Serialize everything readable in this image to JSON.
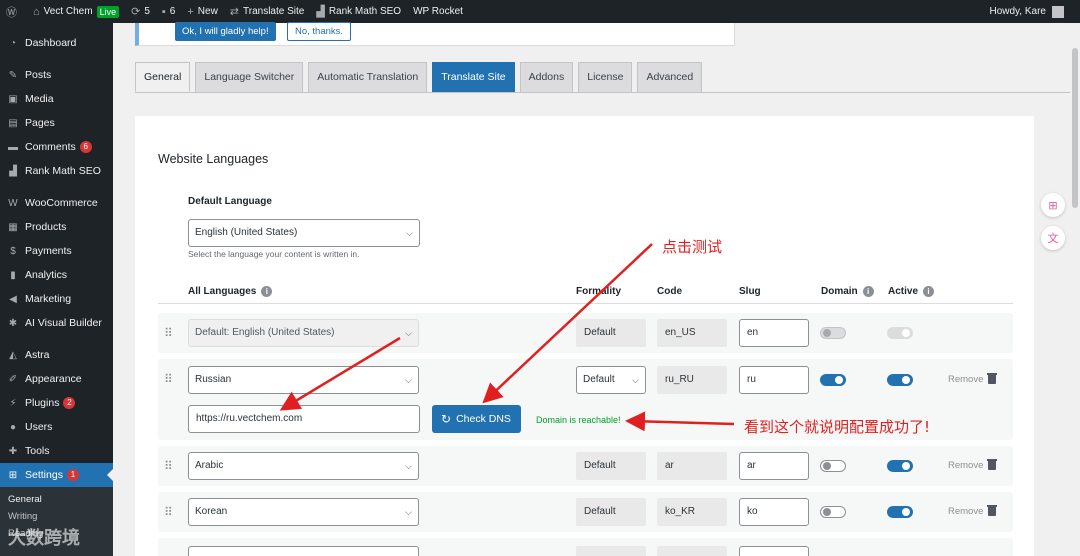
{
  "adminbar": {
    "site_name": "Vect Chem",
    "live_badge": "Live",
    "updates_count": "5",
    "comments_count": "6",
    "new_label": "New",
    "translate_site": "Translate Site",
    "rank_math": "Rank Math SEO",
    "wp_rocket": "WP Rocket",
    "howdy": "Howdy, Kare"
  },
  "sidebar": {
    "items": [
      {
        "label": "Dashboard",
        "icon": "dashboard-icon"
      },
      {
        "label": "Posts",
        "icon": "pin-icon"
      },
      {
        "label": "Media",
        "icon": "media-icon"
      },
      {
        "label": "Pages",
        "icon": "page-icon"
      },
      {
        "label": "Comments",
        "icon": "comment-icon",
        "badge": "6"
      },
      {
        "label": "Rank Math SEO",
        "icon": "chart-icon"
      },
      {
        "label": "WooCommerce",
        "icon": "woo-icon"
      },
      {
        "label": "Products",
        "icon": "box-icon"
      },
      {
        "label": "Payments",
        "icon": "dollar-icon"
      },
      {
        "label": "Analytics",
        "icon": "bar-chart-icon"
      },
      {
        "label": "Marketing",
        "icon": "megaphone-icon"
      },
      {
        "label": "AI Visual Builder",
        "icon": "gear-icon"
      },
      {
        "label": "Astra",
        "icon": "astra-icon"
      },
      {
        "label": "Appearance",
        "icon": "brush-icon"
      },
      {
        "label": "Plugins",
        "icon": "plug-icon",
        "badge": "2"
      },
      {
        "label": "Users",
        "icon": "user-icon"
      },
      {
        "label": "Tools",
        "icon": "wrench-icon"
      },
      {
        "label": "Settings",
        "icon": "settings-icon",
        "badge": "1"
      }
    ],
    "submenu": [
      "General",
      "Writing",
      "Reading"
    ]
  },
  "notice": {
    "accept": "Ok, I will gladly help!",
    "decline": "No, thanks."
  },
  "tabs": [
    "General",
    "Language Switcher",
    "Automatic Translation",
    "Translate Site",
    "Addons",
    "License",
    "Advanced"
  ],
  "panel": {
    "title": "Website Languages",
    "default_language_label": "Default Language",
    "default_language_value": "English (United States)",
    "default_language_help": "Select the language your content is written in.",
    "columns": {
      "all_languages": "All Languages",
      "formality": "Formality",
      "code": "Code",
      "slug": "Slug",
      "domain": "Domain",
      "active": "Active"
    },
    "rows": [
      {
        "language": "Default: English (United States)",
        "formality": "Default",
        "code": "en_US",
        "slug": "en"
      },
      {
        "language": "Russian",
        "formality": "Default",
        "code": "ru_RU",
        "slug": "ru",
        "remove": "Remove",
        "domain_url": "https://ru.vectchem.com",
        "check_dns": "Check DNS",
        "reachable": "Domain is reachable!"
      },
      {
        "language": "Arabic",
        "formality": "Default",
        "code": "ar",
        "slug": "ar",
        "remove": "Remove"
      },
      {
        "language": "Korean",
        "formality": "Default",
        "code": "ko_KR",
        "slug": "ko",
        "remove": "Remove"
      }
    ]
  },
  "annotations": {
    "click_test": "点击测试",
    "success_note": "看到这个就说明配置成功了!"
  },
  "watermark": "大数跨境",
  "colors": {
    "wp_blue": "#2271b1",
    "admin_dark": "#1d2327",
    "success_green": "#00a32a",
    "annotation_red": "#e02020",
    "badge_red": "#d63638"
  }
}
